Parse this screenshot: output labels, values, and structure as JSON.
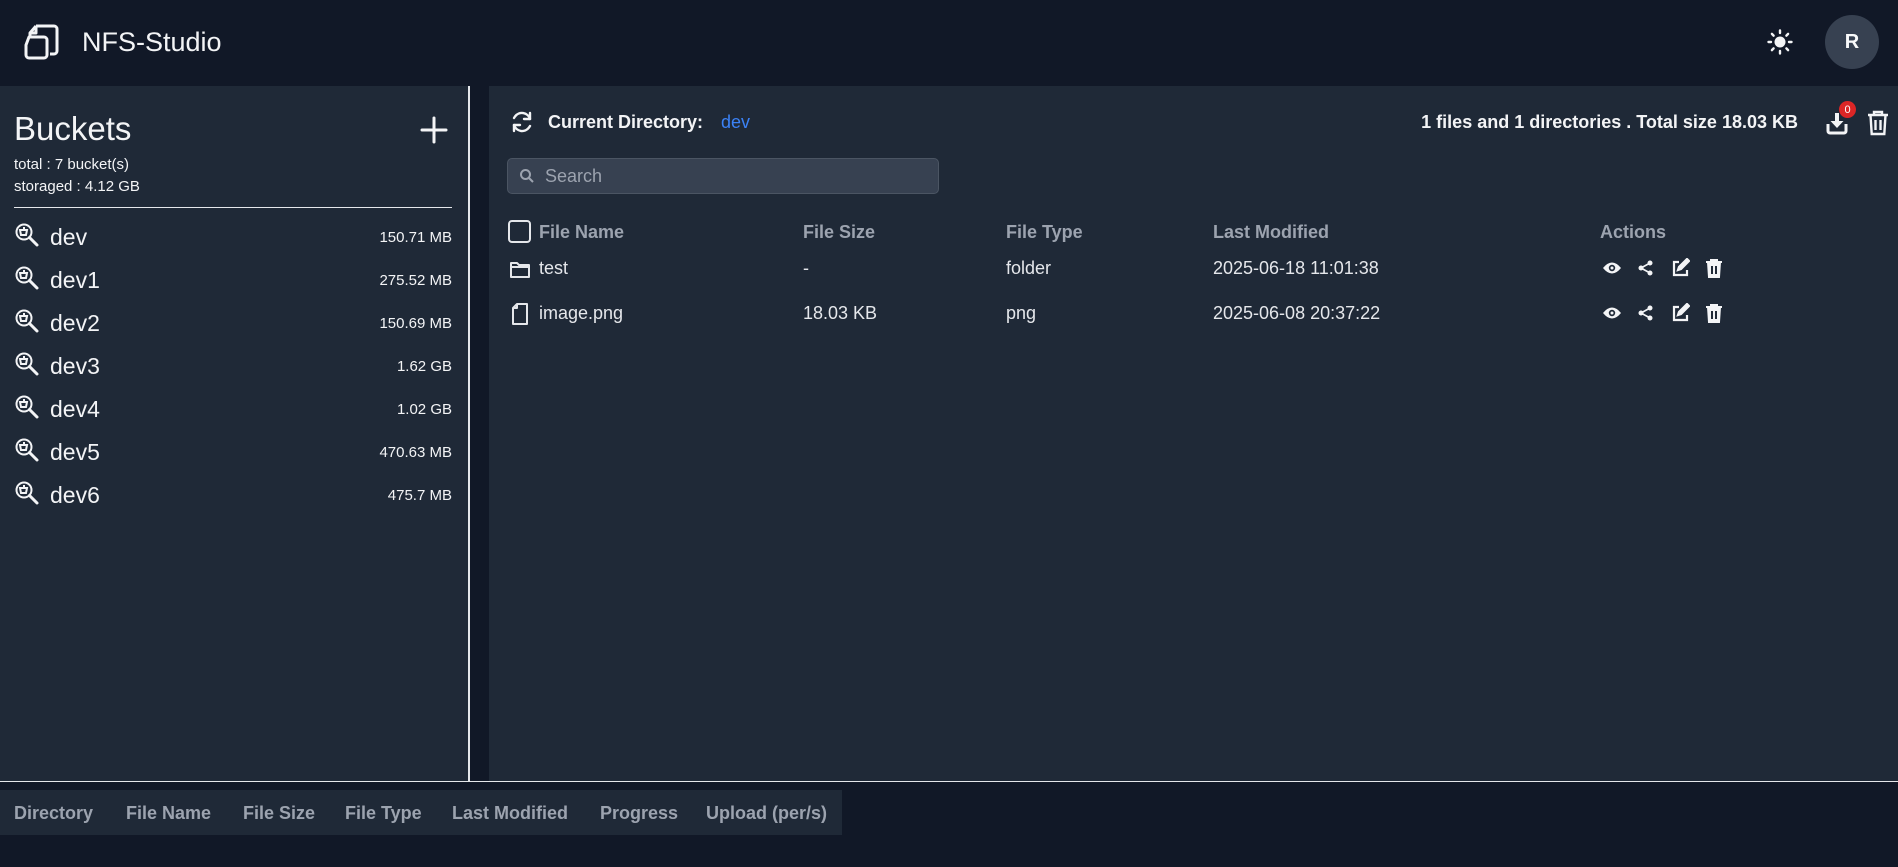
{
  "header": {
    "app_title": "NFS-Studio",
    "user_initial": "R"
  },
  "sidebar": {
    "title": "Buckets",
    "total": "total : 7 bucket(s)",
    "storaged": "storaged : 4.12 GB",
    "buckets": [
      {
        "name": "dev",
        "size": "150.71 MB"
      },
      {
        "name": "dev1",
        "size": "275.52 MB"
      },
      {
        "name": "dev2",
        "size": "150.69 MB"
      },
      {
        "name": "dev3",
        "size": "1.62 GB"
      },
      {
        "name": "dev4",
        "size": "1.02 GB"
      },
      {
        "name": "dev5",
        "size": "470.63 MB"
      },
      {
        "name": "dev6",
        "size": "475.7 MB"
      }
    ]
  },
  "main": {
    "current_directory_label": "Current Directory:",
    "current_directory": "dev",
    "summary": "1 files and 1 directories . Total size 18.03 KB",
    "download_count": "0",
    "search_placeholder": "Search",
    "columns": {
      "name": "File Name",
      "size": "File Size",
      "type": "File Type",
      "modified": "Last Modified",
      "actions": "Actions"
    },
    "rows": [
      {
        "icon": "folder-icon",
        "name": "test",
        "size": "-",
        "type": "folder",
        "modified": "2025-06-18 11:01:38"
      },
      {
        "icon": "file-icon",
        "name": "image.png",
        "size": "18.03 KB",
        "type": "png",
        "modified": "2025-06-08 20:37:22"
      }
    ]
  },
  "upload_panel": {
    "columns": [
      "Directory",
      "File Name",
      "File Size",
      "File Type",
      "Last Modified",
      "Progress",
      "Upload (per/s)"
    ]
  },
  "colors": {
    "background": "#111827",
    "panel": "#1f2937",
    "accent": "#3b82f6",
    "badge": "#dc2626"
  }
}
